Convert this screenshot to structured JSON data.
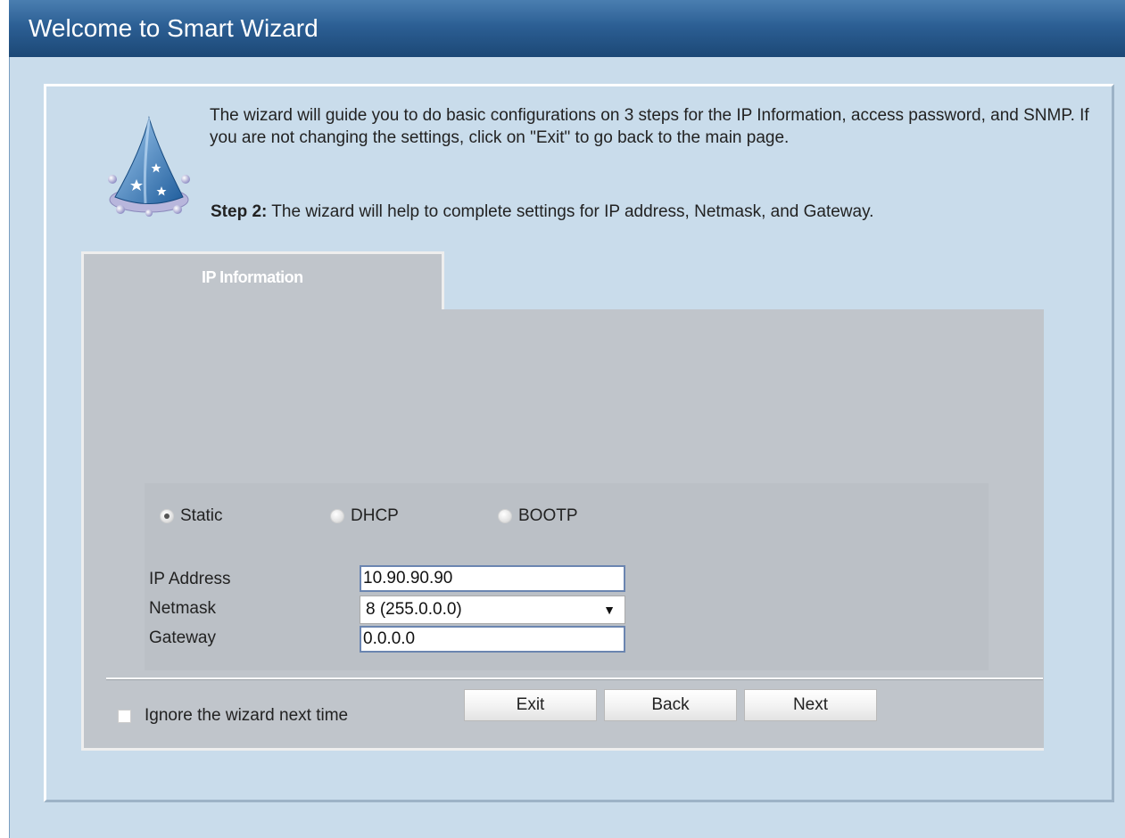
{
  "window": {
    "title": "Welcome to Smart Wizard"
  },
  "intro": {
    "text": "The wizard will guide you to do basic configurations on 3 steps for the IP Information, access password, and SNMP. If you are not changing the settings, click on \"Exit\" to go back to the main page.",
    "step_label": "Step 2:",
    "step_text": " The wizard will help to complete settings for IP address, Netmask, and Gateway."
  },
  "tab": {
    "label": "IP Information"
  },
  "ip_mode": {
    "options": [
      {
        "label": "Static",
        "checked": true
      },
      {
        "label": "DHCP",
        "checked": false
      },
      {
        "label": "BOOTP",
        "checked": false
      }
    ]
  },
  "fields": {
    "ip_address": {
      "label": "IP Address",
      "value": "10.90.90.90"
    },
    "netmask": {
      "label": "Netmask",
      "value": "8 (255.0.0.0)"
    },
    "gateway": {
      "label": "Gateway",
      "value": "0.0.0.0"
    }
  },
  "footer": {
    "ignore_label": "Ignore the wizard next time",
    "ignore_checked": false,
    "exit_label": "Exit",
    "back_label": "Back",
    "next_label": "Next"
  },
  "colors": {
    "title_bar": "#2c5f94",
    "page_background": "#c9dceb",
    "panel_background": "#c0c5cb"
  },
  "icons": {
    "wizard": "wizard-hat-icon",
    "netmask_arrow": "dropdown-arrow-icon"
  }
}
